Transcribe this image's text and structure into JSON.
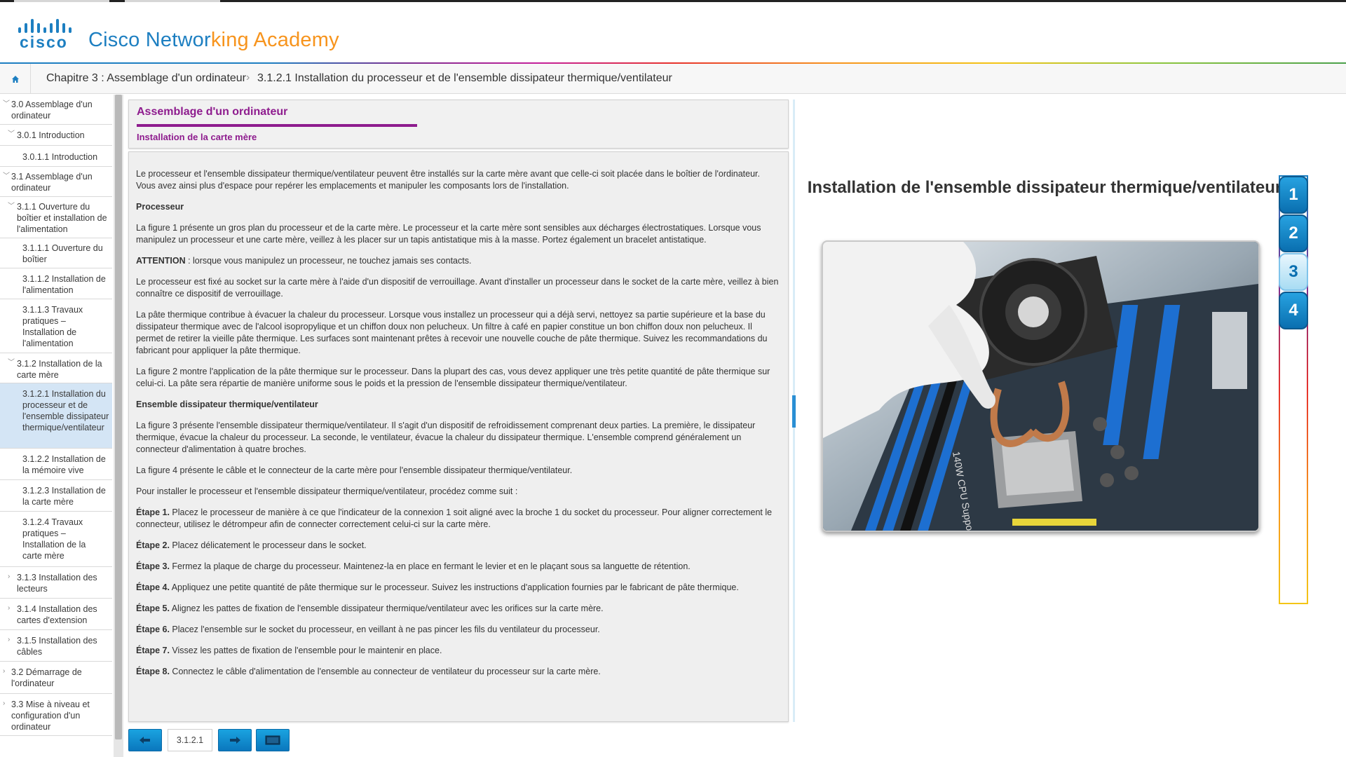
{
  "brand": {
    "logo_word": "cisco",
    "name_part1": "Cisco Networ",
    "name_part2": "k",
    "name_part3": "ing Academy"
  },
  "breadcrumb": {
    "chapter": "Chapitre 3 : Assemblage d'un ordinateur",
    "separator": "›",
    "page": "3.1.2.1 Installation du processeur et de l'ensemble dissipateur thermique/ventilateur"
  },
  "sidebar": {
    "items": [
      {
        "label": "3.0 Assemblage d'un ordinateur"
      },
      {
        "label": "3.0.1 Introduction"
      },
      {
        "label": "3.0.1.1 Introduction"
      },
      {
        "label": "3.1 Assemblage d'un ordinateur"
      },
      {
        "label": "3.1.1 Ouverture du boîtier et installation de l'alimentation"
      },
      {
        "label": "3.1.1.1 Ouverture du boîtier"
      },
      {
        "label": "3.1.1.2 Installation de l'alimentation"
      },
      {
        "label": "3.1.1.3 Travaux pratiques – Installation de l'alimentation"
      },
      {
        "label": "3.1.2 Installation de la carte mère"
      },
      {
        "label": "3.1.2.1 Installation du processeur et de l'ensemble dissipateur thermique/ventilateur"
      },
      {
        "label": "3.1.2.2 Installation de la mémoire vive"
      },
      {
        "label": "3.1.2.3 Installation de la carte mère"
      },
      {
        "label": "3.1.2.4 Travaux pratiques – Installation de la carte mère"
      },
      {
        "label": "3.1.3 Installation des lecteurs"
      },
      {
        "label": "3.1.4 Installation des cartes d'extension"
      },
      {
        "label": "3.1.5 Installation des câbles"
      },
      {
        "label": "3.2 Démarrage de l'ordinateur"
      },
      {
        "label": "3.3 Mise à niveau et configuration d'un ordinateur"
      }
    ]
  },
  "content": {
    "section_title": "Assemblage d'un ordinateur",
    "subsection_title": "Installation de la carte mère",
    "paragraphs": {
      "p1": "Le processeur et l'ensemble dissipateur thermique/ventilateur peuvent être installés sur la carte mère avant que celle-ci soit placée dans le boîtier de l'ordinateur. Vous avez ainsi plus d'espace pour repérer les emplacements et manipuler les composants lors de l'installation.",
      "h1": "Processeur",
      "p2": "La figure 1 présente un gros plan du processeur et de la carte mère. Le processeur et la carte mère sont sensibles aux décharges électrostatiques. Lorsque vous manipulez un processeur et une carte mère, veillez à les placer sur un tapis antistatique mis à la masse. Portez également un bracelet antistatique.",
      "p3_bold": "ATTENTION",
      "p3": " : lorsque vous manipulez un processeur, ne touchez jamais ses contacts.",
      "p4": "Le processeur est fixé au socket sur la carte mère à l'aide d'un dispositif de verrouillage. Avant d'installer un processeur dans le socket de la carte mère, veillez à bien connaître ce dispositif de verrouillage.",
      "p5": "La pâte thermique contribue à évacuer la chaleur du processeur. Lorsque vous installez un processeur qui a déjà servi, nettoyez sa partie supérieure et la base du dissipateur thermique avec de l'alcool isopropylique et un chiffon doux non pelucheux. Un filtre à café en papier constitue un bon chiffon doux non pelucheux. Il permet de retirer la vieille pâte thermique. Les surfaces sont maintenant prêtes à recevoir une nouvelle couche de pâte thermique. Suivez les recommandations du fabricant pour appliquer la pâte thermique.",
      "p6": "La figure 2 montre l'application de la pâte thermique sur le processeur. Dans la plupart des cas, vous devez appliquer une très petite quantité de pâte thermique sur celui-ci. La pâte sera répartie de manière uniforme sous le poids et la pression de l'ensemble dissipateur thermique/ventilateur.",
      "h2": "Ensemble dissipateur thermique/ventilateur",
      "p7": "La figure 3 présente l'ensemble dissipateur thermique/ventilateur. Il s'agit d'un dispositif de refroidissement comprenant deux parties. La première, le dissipateur thermique, évacue la chaleur du processeur. La seconde, le ventilateur, évacue la chaleur du dissipateur thermique. L'ensemble comprend généralement un connecteur d'alimentation à quatre broches.",
      "p8": "La figure 4 présente le câble et le connecteur de la carte mère pour l'ensemble dissipateur thermique/ventilateur.",
      "p9": "Pour installer le processeur et l'ensemble dissipateur thermique/ventilateur, procédez comme suit :"
    },
    "steps": [
      {
        "label": "Étape 1.",
        "text": " Placez le processeur de manière à ce que l'indicateur de la connexion 1 soit aligné avec la broche 1 du socket du processeur. Pour aligner correctement le connecteur, utilisez le détrompeur afin de connecter correctement celui-ci sur la carte mère."
      },
      {
        "label": "Étape 2.",
        "text": " Placez délicatement le processeur dans le socket."
      },
      {
        "label": "Étape 3.",
        "text": " Fermez la plaque de charge du processeur. Maintenez-la en place en fermant le levier et en le plaçant sous sa languette de rétention."
      },
      {
        "label": "Étape 4.",
        "text": " Appliquez une petite quantité de pâte thermique sur le processeur. Suivez les instructions d'application fournies par le fabricant de pâte thermique."
      },
      {
        "label": "Étape 5.",
        "text": " Alignez les pattes de fixation de l'ensemble dissipateur thermique/ventilateur avec les orifices sur la carte mère."
      },
      {
        "label": "Étape 6.",
        "text": " Placez l'ensemble sur le socket du processeur, en veillant à ne pas pincer les fils du ventilateur du processeur."
      },
      {
        "label": "Étape 7.",
        "text": " Vissez les pattes de fixation de l'ensemble pour le maintenir en place."
      },
      {
        "label": "Étape 8.",
        "text": " Connectez le câble d'alimentation de l'ensemble au connecteur de ventilateur du processeur sur la carte mère."
      }
    ]
  },
  "bottom_nav": {
    "prev_icon": "arrow-left-icon",
    "page_number": "3.1.2.1",
    "next_icon": "arrow-right-icon",
    "fullscreen_icon": "window-icon"
  },
  "figure": {
    "title": "Installation de l'ensemble dissipateur thermique/ventilateur",
    "image_description_icon": "cpu-fan-photo",
    "tabs": [
      "1",
      "2",
      "3",
      "4"
    ],
    "active_tab": "3"
  },
  "colors": {
    "brand_blue": "#1d7fc1",
    "brand_orange": "#f7941d",
    "section_purple": "#8e1c8e",
    "active_nav": "#d4e5f5"
  }
}
